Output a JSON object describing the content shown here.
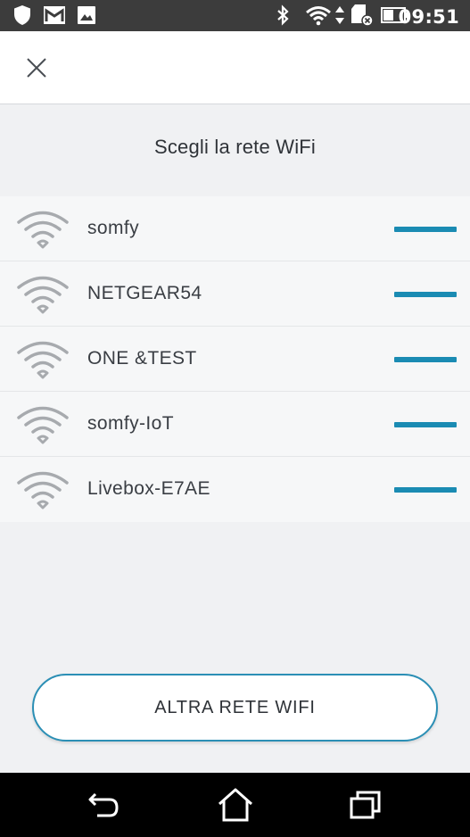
{
  "status_bar": {
    "time": "09:51",
    "left_icons": [
      "shield-icon",
      "gmail-icon",
      "image-icon"
    ],
    "right_icons": [
      "bluetooth-icon",
      "wifi-icon",
      "data-arrows-icon",
      "sd-card-icon",
      "battery-icon"
    ]
  },
  "header": {
    "close_icon": "close-icon"
  },
  "title": "Scegli la rete WiFi",
  "networks": [
    {
      "ssid": "somfy"
    },
    {
      "ssid": "NETGEAR54"
    },
    {
      "ssid": "ONE &TEST"
    },
    {
      "ssid": "somfy-IoT"
    },
    {
      "ssid": "Livebox-E7AE"
    }
  ],
  "other_network_button": "ALTRA RETE WIFI",
  "nav_bar": {
    "icons": [
      "back-icon",
      "home-icon",
      "recents-icon"
    ]
  },
  "colors": {
    "accent": "#1a8bb3",
    "status_bar": "#3c3c3c",
    "background": "#f0f1f3"
  }
}
